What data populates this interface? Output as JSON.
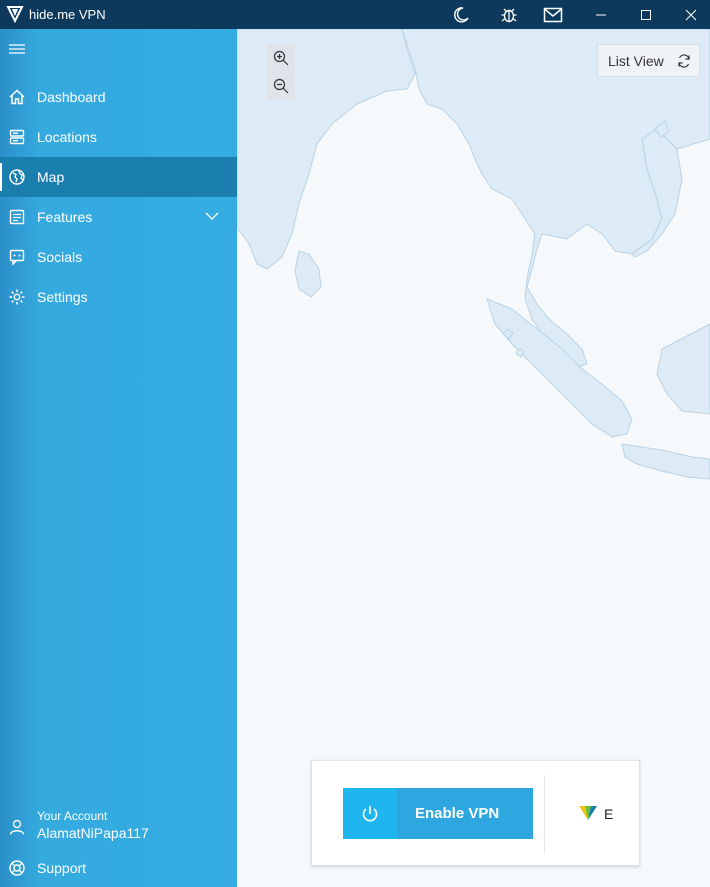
{
  "window": {
    "title": "hide.me VPN"
  },
  "sidebar": {
    "items": [
      {
        "label": "Dashboard"
      },
      {
        "label": "Locations"
      },
      {
        "label": "Map"
      },
      {
        "label": "Features"
      },
      {
        "label": "Socials"
      },
      {
        "label": "Settings"
      }
    ],
    "active": "Map",
    "account_label": "Your Account",
    "account_name": "AlamatNiPapa117",
    "support_label": "Support"
  },
  "map": {
    "list_view_label": "List View",
    "zoom_in_icon": "zoom-in-icon",
    "zoom_out_icon": "zoom-out-icon"
  },
  "vpn": {
    "enable_label": "Enable VPN",
    "server_letter": "E"
  },
  "colors": {
    "sidebar": "#35ace2",
    "sidebar_active": "#1a7eae",
    "titlebar": "#0d3a5c",
    "accent": "#1fb6f0",
    "land": "#dcebf5",
    "marker": "#2a9fd8"
  }
}
